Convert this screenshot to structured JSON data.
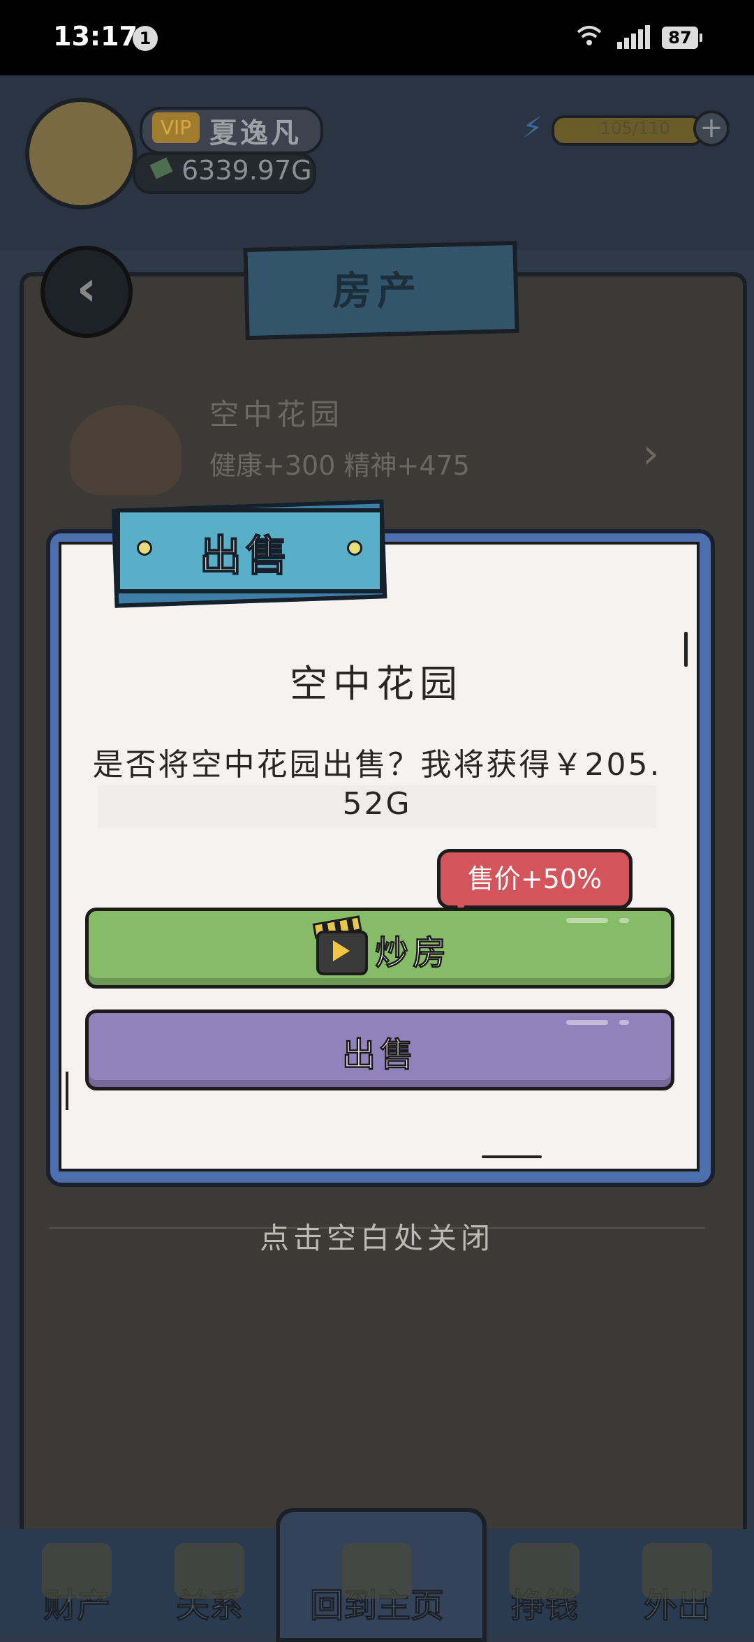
{
  "status_bar": {
    "time": "13:17",
    "notification_count": "1",
    "battery": "87"
  },
  "header": {
    "vip_label": "VIP",
    "player_name": "夏逸凡",
    "money": "6339.97G",
    "energy": "105/110",
    "energy_plus": "+"
  },
  "page": {
    "title": "房产",
    "back_icon": "chevron-left-icon"
  },
  "background_item": {
    "name": "空中花园",
    "stats": "健康+300 精神+475"
  },
  "dialog": {
    "tab_title": "出售",
    "item_name": "空中花园",
    "message": "是否将空中花园出售？我将获得￥205.52G",
    "bonus_bubble": "售价+50%",
    "flip_button": "炒房",
    "sell_button": "出售"
  },
  "close_hint": "点击空白处关闭",
  "bottom_nav": [
    {
      "label": "财产",
      "icon": "house-icon"
    },
    {
      "label": "关系",
      "icon": "contacts-book-icon"
    },
    {
      "label": "回到主页",
      "icon": "return-arrow-icon"
    },
    {
      "label": "挣钱",
      "icon": "fist-icon"
    },
    {
      "label": "外出",
      "icon": "door-icon"
    }
  ],
  "colors": {
    "flip_button": "#86bb68",
    "sell_button": "#9282bc",
    "bonus_bubble": "#d4545c",
    "dialog_frame": "#4e6fae",
    "dialog_tab": "#5aafc8"
  }
}
